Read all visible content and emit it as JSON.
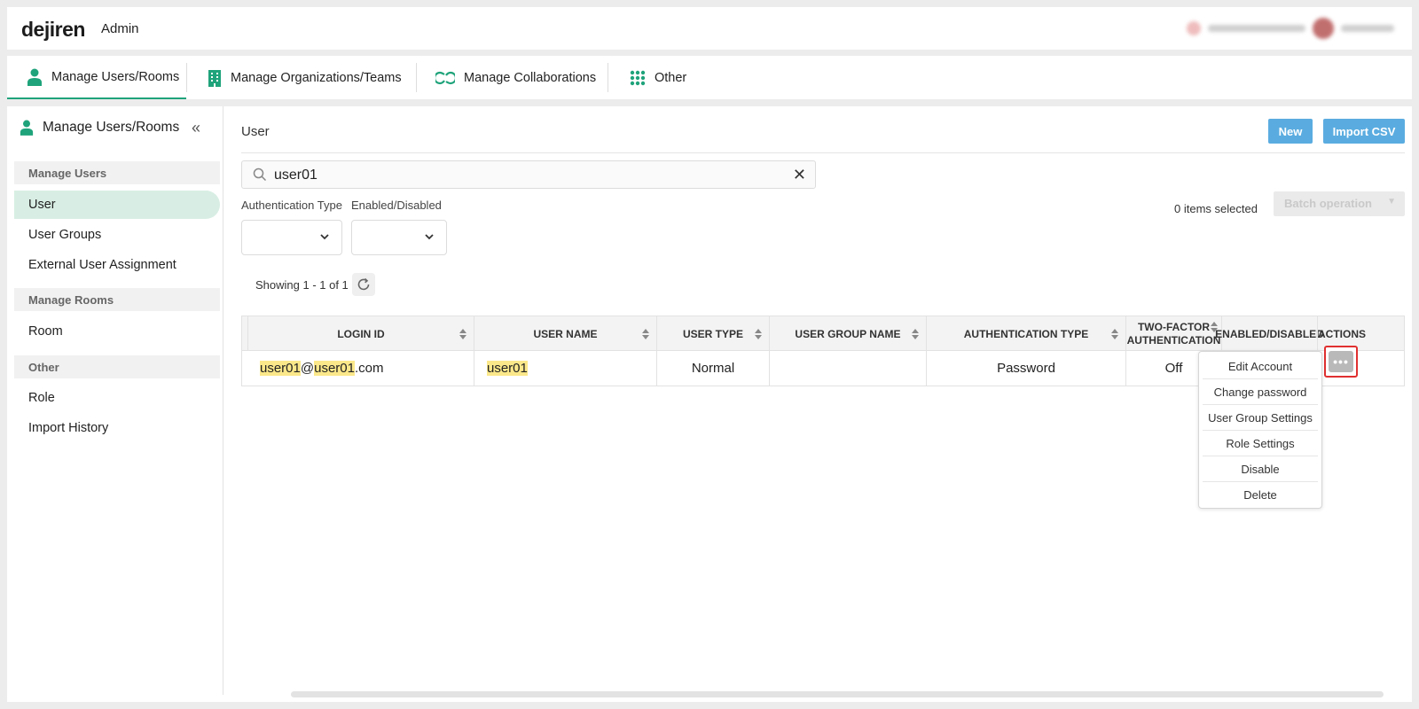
{
  "header": {
    "logo": "dejiren",
    "section": "Admin"
  },
  "nav": {
    "tabs": [
      {
        "label": "Manage Users/Rooms",
        "icon": "person-icon",
        "active": true
      },
      {
        "label": "Manage Organizations/Teams",
        "icon": "building-icon",
        "active": false
      },
      {
        "label": "Manage Collaborations",
        "icon": "link-icon",
        "active": false
      },
      {
        "label": "Other",
        "icon": "grid-dots-icon",
        "active": false
      }
    ]
  },
  "sidebar": {
    "title": "Manage Users/Rooms",
    "sections": [
      {
        "label": "Manage Users",
        "items": [
          "User",
          "User Groups",
          "External User Assignment"
        ]
      },
      {
        "label": "Manage Rooms",
        "items": [
          "Room"
        ]
      },
      {
        "label": "Other",
        "items": [
          "Role",
          "Import History"
        ]
      }
    ],
    "active_item": "User"
  },
  "main": {
    "title": "User",
    "new_label": "New",
    "import_label": "Import CSV",
    "search": {
      "value": "user01",
      "placeholder": ""
    },
    "filters": [
      {
        "label": "Authentication Type",
        "value": ""
      },
      {
        "label": "Enabled/Disabled",
        "value": ""
      }
    ],
    "selected_count": "0 items selected",
    "batch_label": "Batch operation",
    "showing": "Showing 1 - 1 of 1"
  },
  "table": {
    "columns": [
      "LOGIN ID",
      "USER NAME",
      "USER TYPE",
      "USER GROUP NAME",
      "AUTHENTICATION TYPE",
      "TWO-FACTOR AUTHENTICATION",
      "ENABLED/DISABLED",
      "ACTIONS"
    ],
    "rows": [
      {
        "login_id": {
          "hl1": "user01",
          "at": "@",
          "hl2": "user01",
          "domain": ".com"
        },
        "user_name": "user01",
        "user_type": "Normal",
        "user_group_name": "",
        "auth_type": "Password",
        "two_factor": "Off",
        "enabled": ""
      }
    ]
  },
  "actions_menu": {
    "button_label": "•••",
    "items": [
      "Edit Account",
      "Change password",
      "User Group Settings",
      "Role Settings",
      "Disable",
      "Delete"
    ]
  },
  "colors": {
    "accent": "#1fa37a",
    "button": "#5aace0",
    "highlight": "#fbe88a",
    "focus_outline": "#e03030"
  }
}
